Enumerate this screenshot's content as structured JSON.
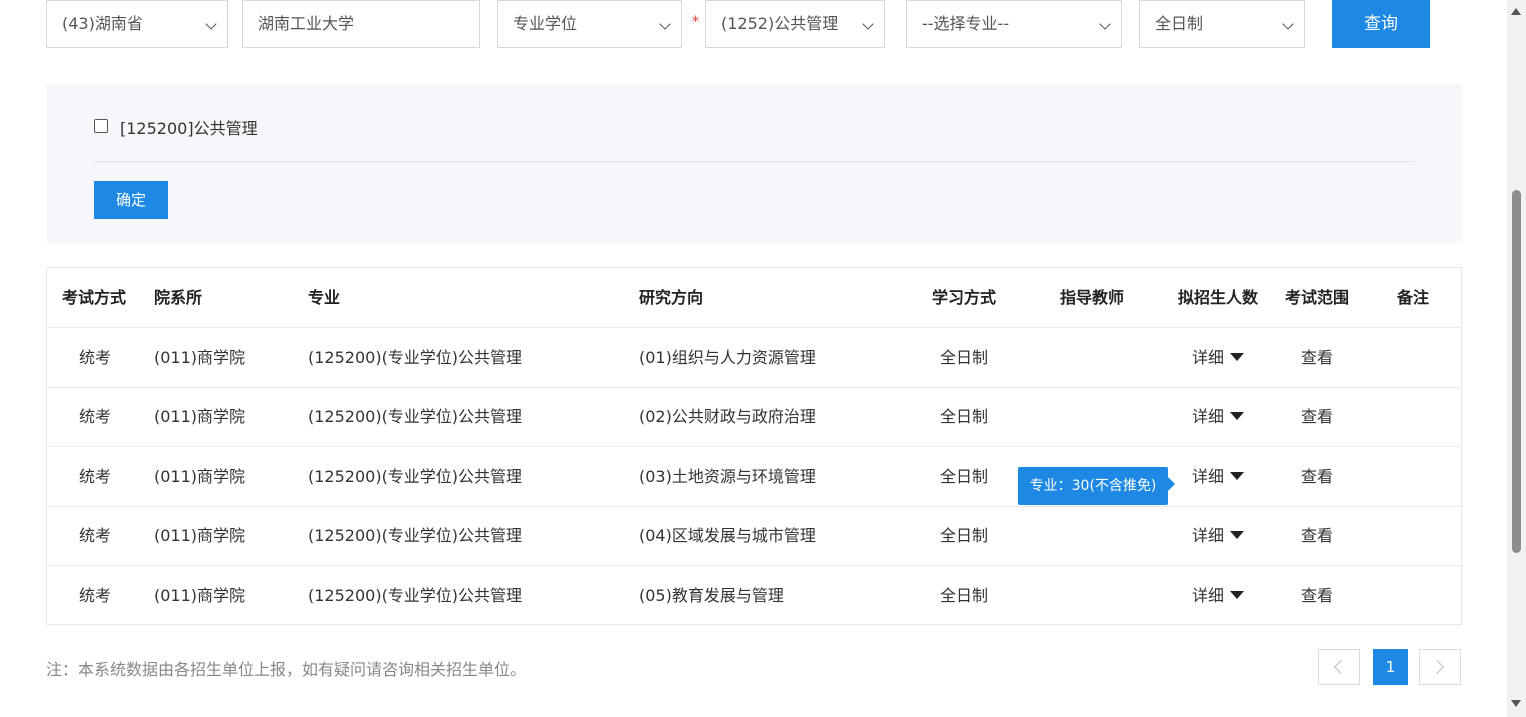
{
  "filters": {
    "province": "(43)湖南省",
    "school": "湖南工业大学",
    "degree_type": "专业学位",
    "required_mark": "*",
    "discipline": "(1252)公共管理",
    "major": "--选择专业--",
    "study_mode": "全日制",
    "query_label": "查询"
  },
  "major_panel": {
    "option_label": "[125200]公共管理",
    "confirm_label": "确定"
  },
  "table": {
    "headers": [
      "考试方式",
      "院系所",
      "专业",
      "研究方向",
      "学习方式",
      "指导教师",
      "拟招生人数",
      "考试范围",
      "备注"
    ],
    "rows": [
      {
        "exam": "统考",
        "dept": "(011)商学院",
        "major": "(125200)(专业学位)公共管理",
        "direction": "(01)组织与人力资源管理",
        "mode": "全日制",
        "advisor": "",
        "quota": "详细",
        "scope": "查看",
        "remark": ""
      },
      {
        "exam": "统考",
        "dept": "(011)商学院",
        "major": "(125200)(专业学位)公共管理",
        "direction": "(02)公共财政与政府治理",
        "mode": "全日制",
        "advisor": "",
        "quota": "详细",
        "scope": "查看",
        "remark": ""
      },
      {
        "exam": "统考",
        "dept": "(011)商学院",
        "major": "(125200)(专业学位)公共管理",
        "direction": "(03)土地资源与环境管理",
        "mode": "全日制",
        "advisor": "",
        "quota": "详细",
        "scope": "查看",
        "remark": ""
      },
      {
        "exam": "统考",
        "dept": "(011)商学院",
        "major": "(125200)(专业学位)公共管理",
        "direction": "(04)区域发展与城市管理",
        "mode": "全日制",
        "advisor": "",
        "quota": "详细",
        "scope": "查看",
        "remark": ""
      },
      {
        "exam": "统考",
        "dept": "(011)商学院",
        "major": "(125200)(专业学位)公共管理",
        "direction": "(05)教育发展与管理",
        "mode": "全日制",
        "advisor": "",
        "quota": "详细",
        "scope": "查看",
        "remark": ""
      }
    ]
  },
  "tooltip": "专业：30(不含推免)",
  "footer": {
    "note": "注：本系统数据由各招生单位上报，如有疑问请咨询相关招生单位。",
    "current_page": "1"
  },
  "colors": {
    "accent": "#1e88e5",
    "panel_bg": "#f5f7fa"
  }
}
